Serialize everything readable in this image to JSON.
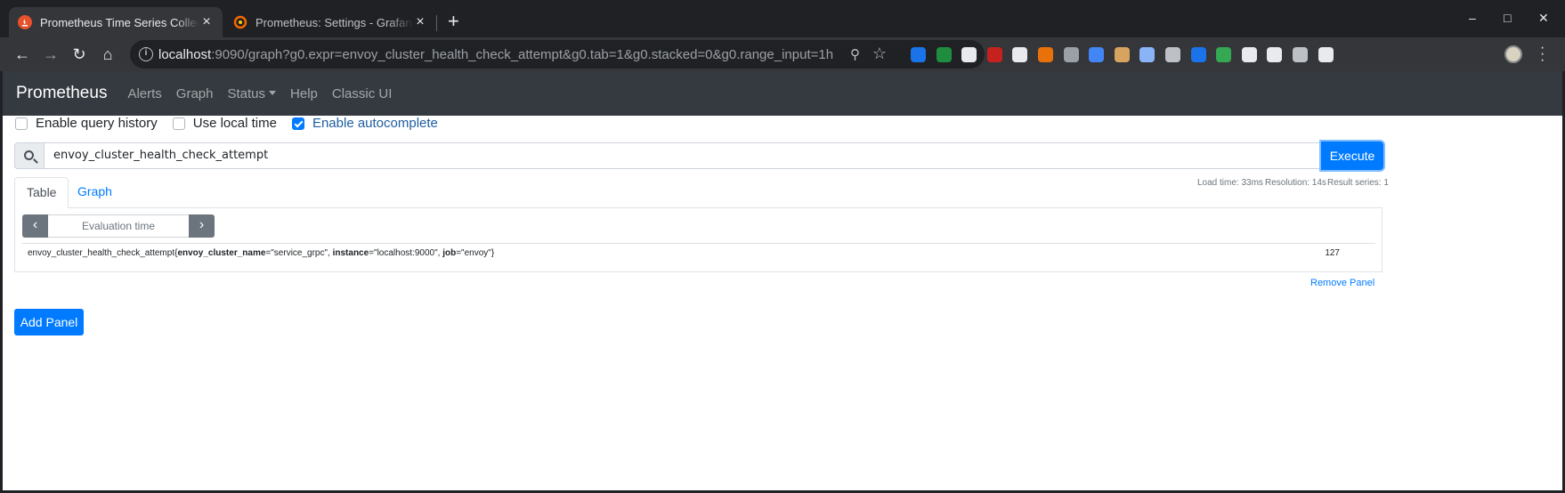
{
  "browser": {
    "tabs": [
      {
        "title": "Prometheus Time Series Collection",
        "active": true
      },
      {
        "title": "Prometheus: Settings - Grafana",
        "active": false
      }
    ],
    "url_host": "localhost",
    "url_rest": ":9090/graph?g0.expr=envoy_cluster_health_check_attempt&g0.tab=1&g0.stacked=0&g0.range_input=1h",
    "extension_colors": [
      "#1a73e8",
      "#1e8e3e",
      "#e8eaed",
      "#c5221f",
      "#e8eaed",
      "#e8710a",
      "#9aa0a6",
      "#4285f4",
      "#d7a45f",
      "#8ab4f8",
      "#bdc1c6",
      "#1a73e8",
      "#34a853",
      "#e8eaed",
      "#e8eaed",
      "#bdc1c6",
      "#e8eaed"
    ]
  },
  "nav": {
    "brand": "Prometheus",
    "links": [
      "Alerts",
      "Graph",
      "Status",
      "Help",
      "Classic UI"
    ]
  },
  "options": {
    "query_history": "Enable query history",
    "local_time": "Use local time",
    "autocomplete": "Enable autocomplete"
  },
  "query": {
    "expr": "envoy_cluster_health_check_attempt",
    "execute_label": "Execute"
  },
  "stats": {
    "load_time": "Load time: 33ms",
    "resolution": "Resolution: 14s",
    "result_series": "Result series: 1"
  },
  "panel_tabs": {
    "table": "Table",
    "graph": "Graph"
  },
  "eval_time_placeholder": "Evaluation time",
  "result": {
    "metric": "envoy_cluster_health_check_attempt",
    "labels": [
      {
        "name": "envoy_cluster_name",
        "value": "\"service_grpc\""
      },
      {
        "name": "instance",
        "value": "\"localhost:9000\""
      },
      {
        "name": "job",
        "value": "\"envoy\""
      }
    ],
    "value": "127"
  },
  "remove_panel": "Remove Panel",
  "add_panel": "Add Panel"
}
